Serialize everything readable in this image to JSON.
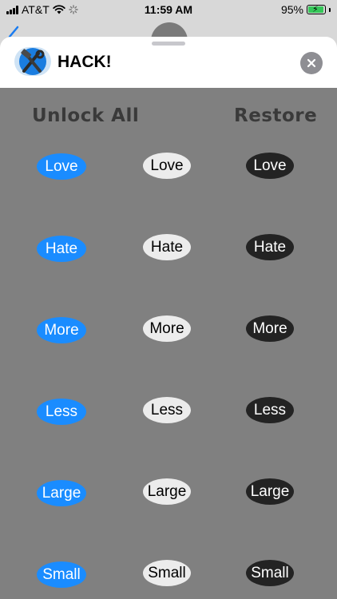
{
  "status_bar": {
    "carrier": "AT&T",
    "time": "11:59 AM",
    "battery": "95%"
  },
  "app": {
    "title": "HACK!"
  },
  "actions": {
    "unlock_all": "Unlock All",
    "restore": "Restore"
  },
  "rows": [
    {
      "blue": "Love",
      "white": "Love",
      "black": "Love"
    },
    {
      "blue": "Hate",
      "white": "Hate",
      "black": "Hate"
    },
    {
      "blue": "More",
      "white": "More",
      "black": "More"
    },
    {
      "blue": "Less",
      "white": "Less",
      "black": "Less"
    },
    {
      "blue": "Large",
      "white": "Large",
      "black": "Large"
    },
    {
      "blue": "Small",
      "white": "Small",
      "black": "Small"
    }
  ],
  "colors": {
    "blue_pill": "#1a8cff",
    "white_pill": "#ececec",
    "black_pill": "#232323",
    "content_bg": "#808080"
  }
}
